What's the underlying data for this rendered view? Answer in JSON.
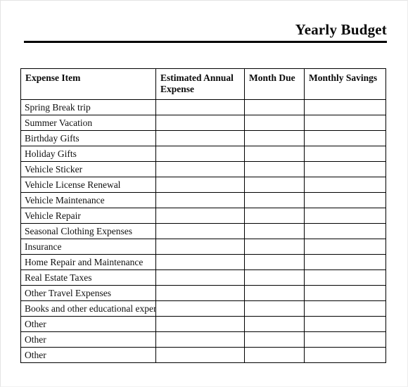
{
  "document": {
    "title": "Yearly Budget"
  },
  "table": {
    "columns": [
      {
        "key": "expense_item",
        "label": "Expense Item"
      },
      {
        "key": "estimated_annual_expense",
        "label": "Estimated Annual Expense"
      },
      {
        "key": "month_due",
        "label": "Month Due"
      },
      {
        "key": "monthly_savings",
        "label": "Monthly Savings"
      }
    ],
    "rows": [
      {
        "expense_item": "Spring Break trip",
        "estimated_annual_expense": "",
        "month_due": "",
        "monthly_savings": ""
      },
      {
        "expense_item": "Summer Vacation",
        "estimated_annual_expense": "",
        "month_due": "",
        "monthly_savings": ""
      },
      {
        "expense_item": "Birthday Gifts",
        "estimated_annual_expense": "",
        "month_due": "",
        "monthly_savings": ""
      },
      {
        "expense_item": "Holiday Gifts",
        "estimated_annual_expense": "",
        "month_due": "",
        "monthly_savings": ""
      },
      {
        "expense_item": "Vehicle Sticker",
        "estimated_annual_expense": "",
        "month_due": "",
        "monthly_savings": ""
      },
      {
        "expense_item": "Vehicle License Renewal",
        "estimated_annual_expense": "",
        "month_due": "",
        "monthly_savings": ""
      },
      {
        "expense_item": "Vehicle Maintenance",
        "estimated_annual_expense": "",
        "month_due": "",
        "monthly_savings": ""
      },
      {
        "expense_item": "Vehicle Repair",
        "estimated_annual_expense": "",
        "month_due": "",
        "monthly_savings": ""
      },
      {
        "expense_item": "Seasonal Clothing Expenses",
        "estimated_annual_expense": "",
        "month_due": "",
        "monthly_savings": ""
      },
      {
        "expense_item": "Insurance",
        "estimated_annual_expense": "",
        "month_due": "",
        "monthly_savings": ""
      },
      {
        "expense_item": "Home Repair and Maintenance",
        "estimated_annual_expense": "",
        "month_due": "",
        "monthly_savings": ""
      },
      {
        "expense_item": "Real Estate Taxes",
        "estimated_annual_expense": "",
        "month_due": "",
        "monthly_savings": ""
      },
      {
        "expense_item": "Other Travel Expenses",
        "estimated_annual_expense": "",
        "month_due": "",
        "monthly_savings": ""
      },
      {
        "expense_item": "Books and other educational expenses",
        "estimated_annual_expense": "",
        "month_due": "",
        "monthly_savings": ""
      },
      {
        "expense_item": "Other",
        "estimated_annual_expense": "",
        "month_due": "",
        "monthly_savings": ""
      },
      {
        "expense_item": "Other",
        "estimated_annual_expense": "",
        "month_due": "",
        "monthly_savings": ""
      },
      {
        "expense_item": "Other",
        "estimated_annual_expense": "",
        "month_due": "",
        "monthly_savings": ""
      }
    ]
  },
  "colors": {
    "text": "#0a0a0a",
    "rule": "#000000",
    "table_border": "#000000",
    "page_background": "#ffffff",
    "page_edge": "#e3e3e3"
  }
}
